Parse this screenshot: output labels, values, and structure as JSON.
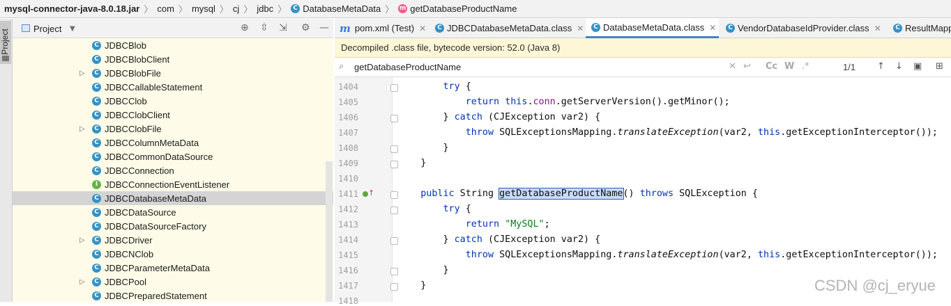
{
  "breadcrumb": {
    "jar": "mysql-connector-java-8.0.18.jar",
    "p1": "com",
    "p2": "mysql",
    "p3": "cj",
    "p4": "jdbc",
    "cls": "DatabaseMetaData",
    "method": "getDatabaseProductName"
  },
  "sidebar": {
    "strip_label": "Project",
    "title": "Project"
  },
  "tree": {
    "items": [
      {
        "label": "JDBCBlob"
      },
      {
        "label": "JDBCBlobClient"
      },
      {
        "label": "JDBCBlobFile"
      },
      {
        "label": "JDBCCallableStatement"
      },
      {
        "label": "JDBCClob"
      },
      {
        "label": "JDBCClobClient"
      },
      {
        "label": "JDBCClobFile"
      },
      {
        "label": "JDBCColumnMetaData"
      },
      {
        "label": "JDBCCommonDataSource"
      },
      {
        "label": "JDBCConnection"
      },
      {
        "label": "JDBCConnectionEventListener"
      },
      {
        "label": "JDBCDatabaseMetaData"
      },
      {
        "label": "JDBCDataSource"
      },
      {
        "label": "JDBCDataSourceFactory"
      },
      {
        "label": "JDBCDriver"
      },
      {
        "label": "JDBCNClob"
      },
      {
        "label": "JDBCParameterMetaData"
      },
      {
        "label": "JDBCPool"
      },
      {
        "label": "JDBCPreparedStatement"
      }
    ]
  },
  "tabs": [
    {
      "label": "pom.xml (Test)"
    },
    {
      "label": "JDBCDatabaseMetaData.class"
    },
    {
      "label": "DatabaseMetaData.class"
    },
    {
      "label": "VendorDatabaseIdProvider.class"
    },
    {
      "label": "ResultMapp"
    }
  ],
  "banner": {
    "text": "Decompiled .class file, bytecode version: 52.0 (Java 8)"
  },
  "search": {
    "query": "getDatabaseProductName",
    "match": "1/1",
    "cc": "Cc",
    "w": "W"
  },
  "editor": {
    "lines": [
      "1404",
      "1405",
      "1406",
      "1407",
      "1408",
      "1409",
      "1410",
      "1411",
      "1412",
      "1413",
      "1414",
      "1415",
      "1416",
      "1417",
      "1418"
    ],
    "t": {
      "try": "try",
      "ret": "return",
      "this": "this",
      "conn": "conn",
      "minor": ".getServerVersion().getMinor();",
      "close": "}",
      "catch": "catch",
      "catchp": " (CJException var2) {",
      "throw": "throw",
      "sqlmap": " SQLExceptionsMapping.",
      "translate": "translateException",
      "args": "(var2, ",
      "interceptor": ".getExceptionInterceptor());",
      "public": "public",
      "string": " String ",
      "method": "getDatabaseProductName",
      "paren": "() ",
      "throws": "throws",
      "sqle": " SQLException {",
      "brace": " {",
      "dot": ".",
      "space": " ",
      "mysql": "\"MySQL\"",
      "semi": ";"
    }
  },
  "watermark": "CSDN @cj_eryue"
}
